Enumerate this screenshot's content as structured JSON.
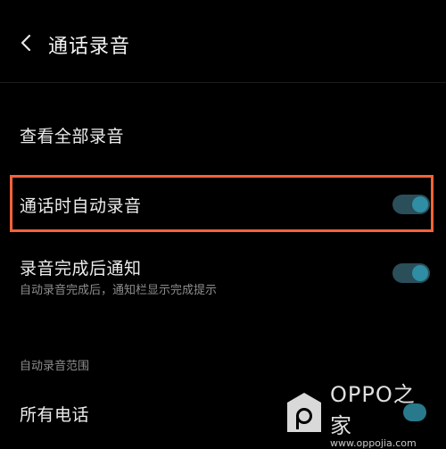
{
  "header": {
    "title": "通话录音"
  },
  "rows": {
    "view_all": {
      "label": "查看全部录音"
    },
    "auto_record": {
      "label": "通话时自动录音",
      "enabled": true
    },
    "notify": {
      "label": "录音完成后通知",
      "subtitle": "自动录音完成后，通知栏显示完成提示",
      "enabled": true
    }
  },
  "section": {
    "range_label": "自动录音范围",
    "all_calls_label": "所有电话"
  },
  "watermark": {
    "brand": "OPPO之家",
    "url": "www.oppojia.com"
  },
  "colors": {
    "background": "#000000",
    "accent": "#2f8ea3",
    "highlight": "#f2633a"
  }
}
